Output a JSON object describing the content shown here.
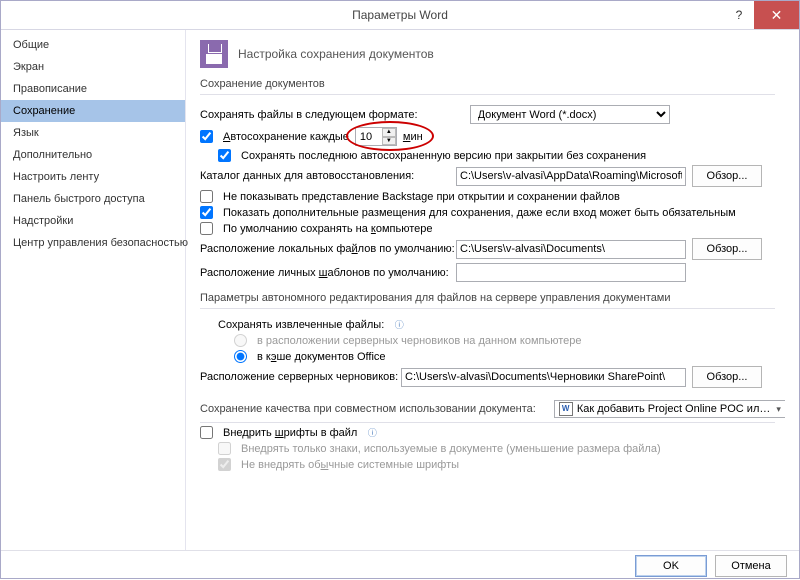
{
  "titlebar": {
    "title": "Параметры Word"
  },
  "sidebar": {
    "items": [
      "Общие",
      "Экран",
      "Правописание",
      "Сохранение",
      "Язык",
      "Дополнительно",
      "Настроить ленту",
      "Панель быстрого доступа",
      "Надстройки",
      "Центр управления безопасностью"
    ],
    "active_index": 3
  },
  "header": {
    "label": "Настройка сохранения документов"
  },
  "section_save": {
    "title": "Сохранение документов",
    "save_format_label": "Сохранять файлы в следующем формате:",
    "save_format_value": "Документ Word (*.docx)",
    "autosave_label_pre": "Автосохранение каждые",
    "autosave_minutes": "10",
    "autosave_label_post": "мин",
    "keep_last_autosave": "Сохранять последнюю автосохраненную версию при закрытии без сохранения",
    "autorecover_dir_label": "Каталог данных для автовосстановления:",
    "autorecover_dir_value": "C:\\Users\\v-alvasi\\AppData\\Roaming\\Microsoft\\Word",
    "no_backstage": "Не показывать представление Backstage при открытии и сохранении файлов",
    "show_additional": "Показать дополнительные размещения для сохранения, даже если вход может быть обязательным",
    "default_computer": "По умолчанию сохранять на компьютере",
    "local_files_label": "Расположение локальных файлов по умолчанию:",
    "local_files_value": "C:\\Users\\v-alvasi\\Documents\\",
    "templates_label": "Расположение личных шаблонов по умолчанию:",
    "templates_value": "",
    "browse": "Обзор..."
  },
  "section_offline": {
    "title": "Параметры автономного редактирования для файлов на сервере управления документами",
    "save_extracted_label": "Сохранять извлеченные файлы:",
    "radio_server_drafts": "в расположении серверных черновиков на данном компьютере",
    "radio_office_cache": "в кэше документов Office",
    "drafts_label": "Расположение серверных черновиков:",
    "drafts_value": "C:\\Users\\v-alvasi\\Documents\\Черновики SharePoint\\",
    "browse": "Обзор..."
  },
  "section_quality": {
    "title": "Сохранение качества при совместном использовании документа:",
    "doc_selector": "Как добавить Project Online POC или D...",
    "embed_fonts": "Внедрить шрифты в файл",
    "embed_used": "Внедрять только знаки, используемые в документе (уменьшение размера файла)",
    "no_system_fonts": "Не внедрять обычные системные шрифты"
  },
  "footer": {
    "ok": "OK",
    "cancel": "Отмена"
  }
}
